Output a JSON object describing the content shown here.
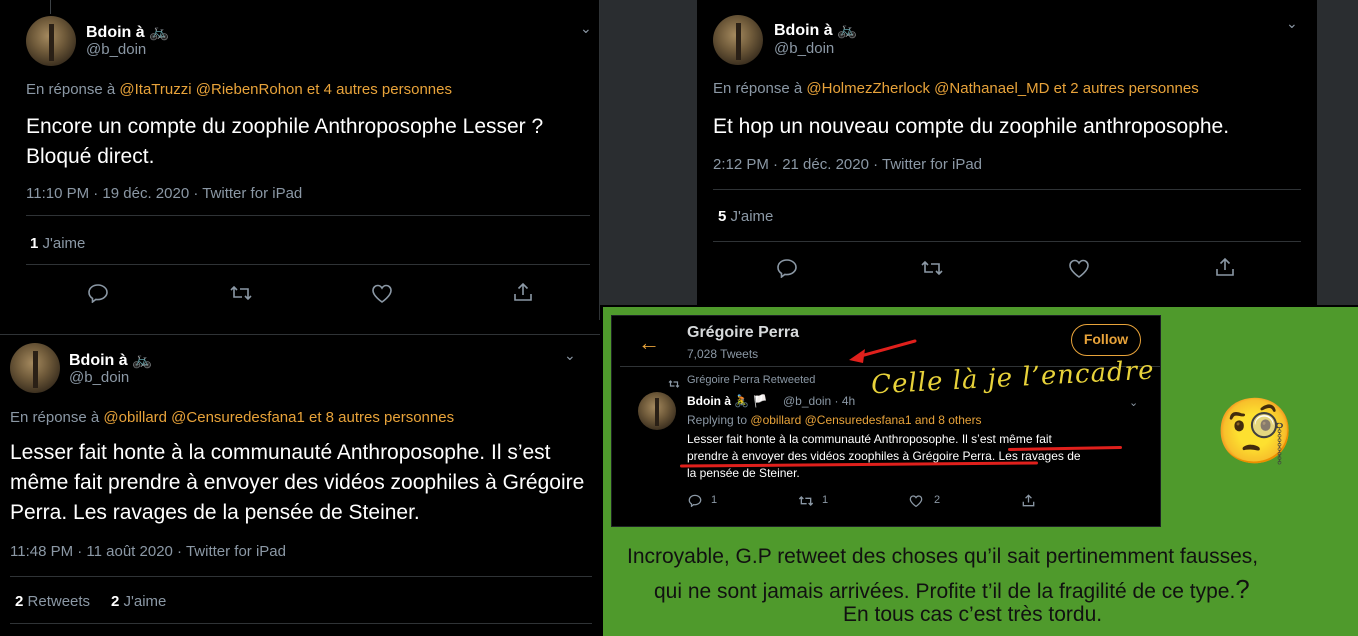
{
  "tweet1": {
    "name": "Bdoin à 🚲",
    "handle": "@b_doin",
    "reply_prefix": "En réponse à",
    "mentions": "@ItaTruzzi @RiebenRohon",
    "others": "et 4 autres personnes",
    "text": "Encore un compte du zoophile Anthroposophe Lesser ?\nBloqué direct.",
    "meta": "11:10 PM · 19 déc. 2020 · Twitter for iPad",
    "likes_count": "1",
    "likes_label": "J'aime"
  },
  "tweet2": {
    "name": "Bdoin à 🚲",
    "handle": "@b_doin",
    "reply_prefix": "En réponse à",
    "mentions": "@HolmezZherlock @Nathanael_MD",
    "others": "et 2 autres personnes",
    "text": "Et hop un nouveau compte du zoophile anthroposophe.",
    "meta": "2:12 PM · 21 déc. 2020 · Twitter for iPad",
    "likes_count": "5",
    "likes_label": "J'aime"
  },
  "tweet3": {
    "name": "Bdoin à 🚲",
    "handle": "@b_doin",
    "reply_prefix": "En réponse à",
    "mentions": "@obillard @Censuredesfana1",
    "others": "et 8 autres personnes",
    "text": "Lesser fait honte à la communauté Anthroposophe. Il s’est même fait prendre à envoyer des vidéos zoophiles à Grégoire Perra. Les ravages de la pensée de Steiner.",
    "meta": "11:48 PM · 11 août 2020 · Twitter for iPad",
    "retweets_count": "2",
    "retweets_label": "Retweets",
    "likes_count": "2",
    "likes_label": "J'aime"
  },
  "profile": {
    "back_arrow": "←",
    "name": "Grégoire Perra",
    "tweets_count": "7,028 Tweets",
    "follow_label": "Follow",
    "retweeted_by": "Grégoire Perra Retweeted",
    "inner_name": "Bdoin à 🚴 🏳️",
    "inner_handle": "@b_doin · 4h",
    "replying_to": "Replying to",
    "replying_mentions": "@obillard @Censuredesfana1 and 8 others",
    "inner_text_line1": "Lesser fait honte à la communauté Anthroposophe. Il s’est même fait",
    "inner_text_line2": "prendre à envoyer des vidéos zoophiles à Grégoire Perra. Les ravages de",
    "inner_text_line3": "la pensée de Steiner.",
    "reply_count": "1",
    "retweet_count": "1",
    "like_count": "2"
  },
  "annotation": {
    "handwritten": "Celle là je l’encadre",
    "emoji": "🧐",
    "comment_line1": "Incroyable, G.P retweet des choses qu’il sait pertinemment fausses,",
    "comment_line2": "qui ne sont jamais arrivées. Profite t’il de la fragilité de ce type.",
    "comment_q": "?",
    "comment_line3": "En tous cas c’est très tordu."
  },
  "colors": {
    "background": "#000000",
    "mention": "#e8a33a",
    "secondary_text": "#8b98a5",
    "green_panel": "#4f9a2c",
    "annotation_red": "#e0201c",
    "handwriting_gold": "#e8d23a"
  }
}
